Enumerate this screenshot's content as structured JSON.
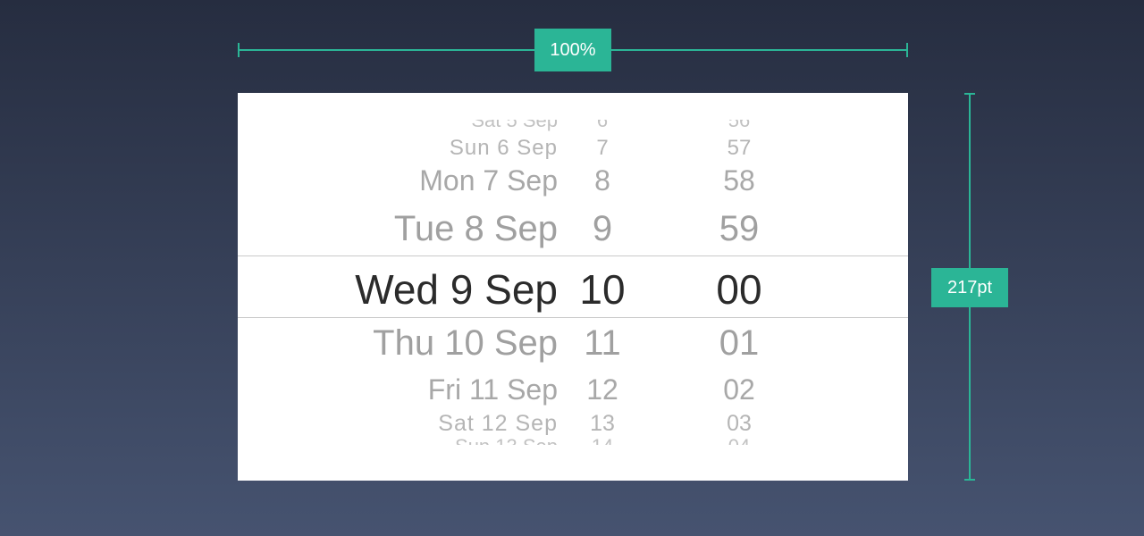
{
  "annotations": {
    "width_label": "100%",
    "height_label": "217pt"
  },
  "picker": {
    "rows": [
      {
        "date": "Sat 5 Sep",
        "hour": "6",
        "minute": "56"
      },
      {
        "date": "Sun 6 Sep",
        "hour": "7",
        "minute": "57"
      },
      {
        "date": "Mon 7 Sep",
        "hour": "8",
        "minute": "58"
      },
      {
        "date": "Tue 8 Sep",
        "hour": "9",
        "minute": "59"
      },
      {
        "date": "Wed 9 Sep",
        "hour": "10",
        "minute": "00"
      },
      {
        "date": "Thu 10 Sep",
        "hour": "11",
        "minute": "01"
      },
      {
        "date": "Fri 11 Sep",
        "hour": "12",
        "minute": "02"
      },
      {
        "date": "Sat 12 Sep",
        "hour": "13",
        "minute": "03"
      },
      {
        "date": "Sun 13 Sep",
        "hour": "14",
        "minute": "04"
      }
    ],
    "selected_index": 4
  },
  "colors": {
    "accent": "#2bb596",
    "selected_text": "#2b2b2b",
    "unselected_text": "#a0a0a0",
    "background_top": "#262d40",
    "background_bottom": "#465370"
  }
}
